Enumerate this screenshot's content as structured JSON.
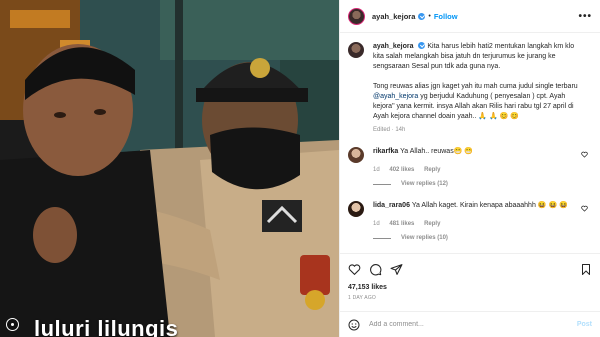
{
  "post": {
    "username": "ayah_kejora",
    "follow_label": "Follow",
    "more_label": "•••",
    "caption_line1": "Kita harus lebih hati2 mentukan langkah km klo kita salah melangkah bisa jatuh dn terjurumus ke jurang ke sengsaraan Sesal pun tdk ada guna nya.",
    "caption_line2_pre": "Tong reuwas alias jgn kaget yah itu mah cuma judul single terbaru",
    "caption_mention": "@ayah_kejora",
    "caption_line2_post": "yg berjudul Kaduhung ( penyesalan ) cpt. Ayah kejora\" yana kermit. insya Allah akan Rilis hari rabu tgl 27 april di Ayah kejora channel doain yaah.. 🙏 🙏 😊 😊",
    "edited": "Edited · 14h",
    "likes": "47,153 likes",
    "time": "1 DAY AGO",
    "media_caption": "luluri lilungis"
  },
  "comments": [
    {
      "username": "rikarfka",
      "text": "Ya Allah.. reuwas😁 😁",
      "time": "1d",
      "likes": "402 likes",
      "reply": "Reply",
      "replies": "View replies (12)"
    },
    {
      "username": "lida_rara06",
      "text": "Ya Allah kaget. Kirain kenapa abaaahhh 😆 😆 😆",
      "time": "1d",
      "likes": "481 likes",
      "reply": "Reply",
      "replies": "View replies (10)"
    }
  ],
  "composer": {
    "placeholder": "Add a comment...",
    "post_label": "Post"
  },
  "colors": {
    "accent": "#0095f6",
    "verified": "#3897f0",
    "muted": "#8e8e8e"
  },
  "icons": [
    "heart-icon",
    "comment-icon",
    "share-icon",
    "bookmark-icon",
    "emoji-icon",
    "more-icon"
  ]
}
